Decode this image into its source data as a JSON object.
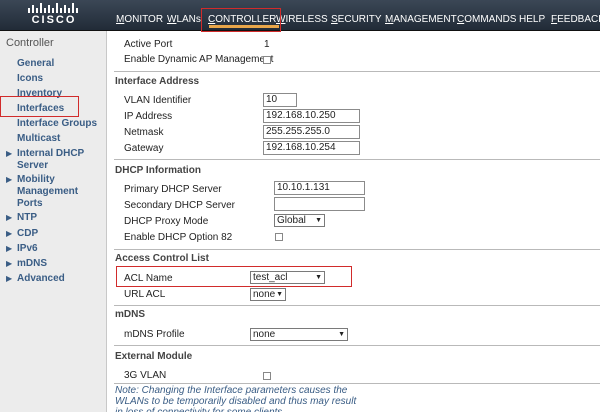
{
  "brand": {
    "logo_text": "CISCO"
  },
  "menu": {
    "items": [
      {
        "first": "M",
        "rest": "ONITOR"
      },
      {
        "first": "W",
        "rest": "LANs"
      },
      {
        "first": "C",
        "rest": "ONTROLLER"
      },
      {
        "first": "W",
        "rest": "IRELESS"
      },
      {
        "first": "S",
        "rest": "ECURITY"
      },
      {
        "first": "M",
        "rest": "ANAGEMENT"
      },
      {
        "first": "C",
        "rest": "OMMANDS"
      },
      {
        "first": "",
        "rest": "HELP"
      },
      {
        "first": "F",
        "rest": "EEDBACK"
      }
    ],
    "active": "CONTROLLER",
    "accent_color": "#e8a64a",
    "highlight_color": "#d12b2b"
  },
  "sidebar": {
    "title": "Controller",
    "items": [
      {
        "label": "General",
        "expandable": false
      },
      {
        "label": "Icons",
        "expandable": false
      },
      {
        "label": "Inventory",
        "expandable": false
      },
      {
        "label": "Interfaces",
        "expandable": false,
        "highlighted": true
      },
      {
        "label": "Interface Groups",
        "expandable": false
      },
      {
        "label": "Multicast",
        "expandable": false
      },
      {
        "label": "Internal DHCP",
        "label2": "Server",
        "expandable": true
      },
      {
        "label": "Mobility",
        "label2": "Management",
        "expandable": true
      },
      {
        "label": "Ports",
        "expandable": false
      },
      {
        "label": "NTP",
        "expandable": true
      },
      {
        "label": "CDP",
        "expandable": true
      },
      {
        "label": "IPv6",
        "expandable": true
      },
      {
        "label": "mDNS",
        "expandable": true
      },
      {
        "label": "Advanced",
        "expandable": true
      }
    ]
  },
  "form": {
    "active_port_label": "Active Port",
    "active_port_value": "1",
    "dynamic_ap_label": "Enable Dynamic AP Management",
    "interface_address": {
      "title": "Interface Address",
      "vlan_label": "VLAN Identifier",
      "vlan_value": "10",
      "ip_label": "IP Address",
      "ip_value": "192.168.10.250",
      "netmask_label": "Netmask",
      "netmask_value": "255.255.255.0",
      "gateway_label": "Gateway",
      "gateway_value": "192.168.10.254"
    },
    "dhcp": {
      "title": "DHCP Information",
      "primary_label": "Primary DHCP Server",
      "primary_value": "10.10.1.131",
      "secondary_label": "Secondary DHCP Server",
      "secondary_value": "",
      "proxy_label": "DHCP Proxy Mode",
      "proxy_value": "Global",
      "option82_label": "Enable DHCP Option 82"
    },
    "acl": {
      "title": "Access Control List",
      "acl_name_label": "ACL Name",
      "acl_name_value": "test_acl",
      "url_acl_label": "URL ACL",
      "url_acl_value": "none"
    },
    "mdns": {
      "title": "mDNS",
      "profile_label": "mDNS Profile",
      "profile_value": "none"
    },
    "external": {
      "title": "External Module",
      "vlan3g_label": "3G VLAN"
    },
    "note": "Note: Changing the Interface parameters causes the WLANs to be temporarily disabled and thus may result in loss of connectivity for some clients."
  }
}
